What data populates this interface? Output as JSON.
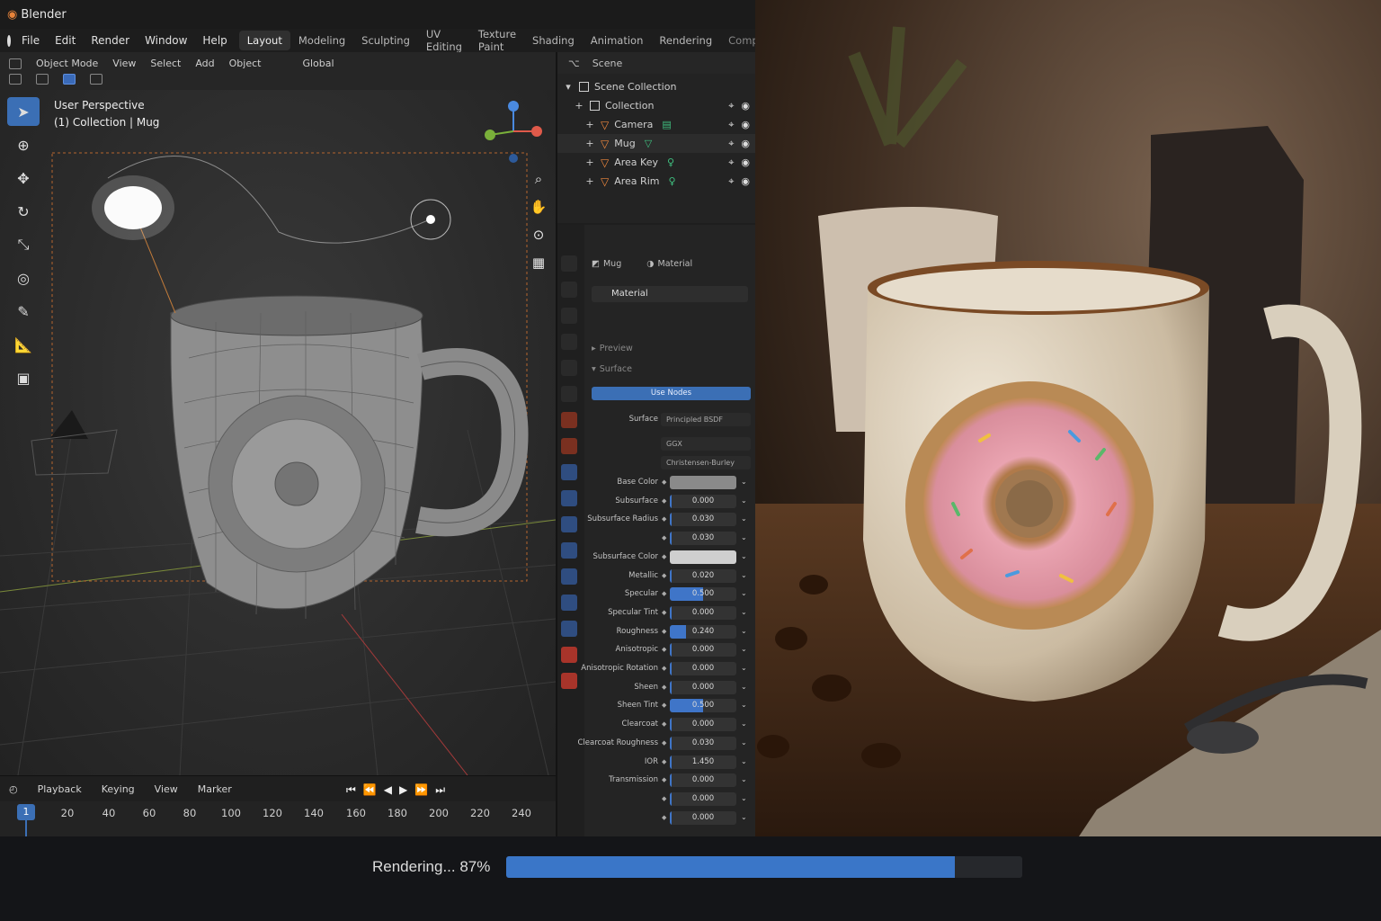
{
  "app": {
    "title": "Blender"
  },
  "menu": {
    "items": [
      "File",
      "Edit",
      "Render",
      "Window",
      "Help"
    ],
    "workspaces": [
      "Layout",
      "Modeling",
      "Sculpting",
      "UV Editing",
      "Texture Paint",
      "Shading",
      "Animation",
      "Rendering",
      "Compositing"
    ],
    "active_workspace": "Layout"
  },
  "viewport": {
    "header": {
      "mode": "Object Mode",
      "view": "View",
      "select": "Select",
      "add": "Add",
      "object": "Object",
      "orientation": "Global"
    },
    "info_line1": "User Perspective",
    "info_line2": "(1) Collection | Mug"
  },
  "timeline": {
    "menu": [
      "Playback",
      "Keying",
      "View",
      "Marker"
    ],
    "current_frame": "1",
    "ticks": [
      "20",
      "40",
      "60",
      "80",
      "100",
      "120",
      "140",
      "160",
      "180",
      "200",
      "220",
      "240"
    ]
  },
  "outliner": {
    "header": "Scene",
    "root": "Scene Collection",
    "collection": "Collection",
    "objects": [
      "Camera",
      "Mug",
      "Area Key",
      "Area Rim"
    ]
  },
  "properties": {
    "breadcrumb_object": "Mug",
    "breadcrumb_material": "Material",
    "material_slot": "Material",
    "panel_preview": "Preview",
    "panel_surface": "Surface",
    "use_nodes": "Use Nodes",
    "surface_label": "Surface",
    "surface_value": "Principled BSDF",
    "distribution": "GGX",
    "subsurface_method": "Christensen-Burley",
    "fields": [
      {
        "label": "Base Color",
        "value": "",
        "kind": "color"
      },
      {
        "label": "Subsurface",
        "value": "0.000",
        "kind": "num",
        "fill": 0
      },
      {
        "label": "Subsurface Radius",
        "value": "0.030",
        "kind": "num",
        "fill": 0
      },
      {
        "label": "",
        "value": "0.030",
        "kind": "num",
        "fill": 0
      },
      {
        "label": "Subsurface Color",
        "value": "",
        "kind": "colorlight"
      },
      {
        "label": "Metallic",
        "value": "0.020",
        "kind": "num",
        "fill": 0.02
      },
      {
        "label": "Specular",
        "value": "0.500",
        "kind": "num",
        "fill": 0.5
      },
      {
        "label": "Specular Tint",
        "value": "0.000",
        "kind": "num",
        "fill": 0
      },
      {
        "label": "Roughness",
        "value": "0.240",
        "kind": "num",
        "fill": 0.24
      },
      {
        "label": "Anisotropic",
        "value": "0.000",
        "kind": "num",
        "fill": 0
      },
      {
        "label": "Anisotropic Rotation",
        "value": "0.000",
        "kind": "num",
        "fill": 0
      },
      {
        "label": "Sheen",
        "value": "0.000",
        "kind": "num",
        "fill": 0
      },
      {
        "label": "Sheen Tint",
        "value": "0.500",
        "kind": "num",
        "fill": 0.5
      },
      {
        "label": "Clearcoat",
        "value": "0.000",
        "kind": "num",
        "fill": 0
      },
      {
        "label": "Clearcoat Roughness",
        "value": "0.030",
        "kind": "num",
        "fill": 0.03
      },
      {
        "label": "IOR",
        "value": "1.450",
        "kind": "num",
        "fill": 0
      },
      {
        "label": "Transmission",
        "value": "0.000",
        "kind": "num",
        "fill": 0
      },
      {
        "label": "",
        "value": "0.000",
        "kind": "num",
        "fill": 0
      },
      {
        "label": "",
        "value": "0.000",
        "kind": "num",
        "fill": 0
      }
    ]
  },
  "render": {
    "status_text": "Rendering... 87%",
    "progress": 0.87
  },
  "colors": {
    "accent": "#3b6fb5",
    "object_icon": "#f0883e",
    "data_icon": "#3fbf7f"
  }
}
